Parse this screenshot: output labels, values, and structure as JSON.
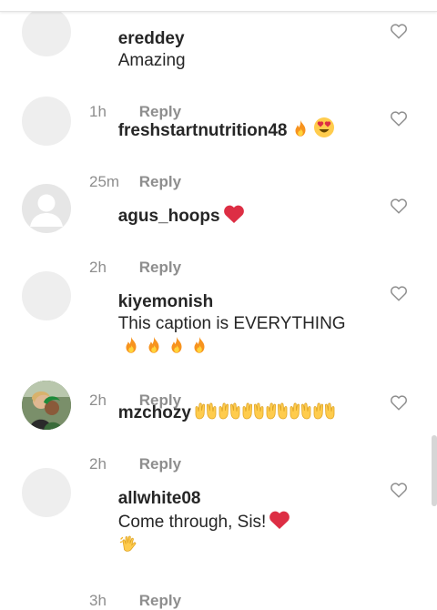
{
  "comments": [
    {
      "username": "ereddey",
      "text": "Amazing",
      "time": "1h",
      "reply": "Reply",
      "emoji": []
    },
    {
      "username": "freshstartnutrition48",
      "text": "",
      "time": "25m",
      "reply": "Reply",
      "emoji": [
        "fire",
        "heart-eyes"
      ]
    },
    {
      "username": "agus_hoops",
      "text": "",
      "time": "2h",
      "reply": "Reply",
      "emoji": [
        "red-heart"
      ]
    },
    {
      "username": "kiyemonish",
      "text": "This caption is EVERYTHING",
      "time": "2h",
      "reply": "Reply",
      "emoji": [
        "fire",
        "fire",
        "fire",
        "fire"
      ]
    },
    {
      "username": "mzchozy",
      "text": "",
      "time": "2h",
      "reply": "Reply",
      "emoji": [
        "raising-hands",
        "raising-hands",
        "raising-hands",
        "raising-hands",
        "raising-hands",
        "raising-hands"
      ]
    },
    {
      "username": "allwhite08",
      "text": "Come through, Sis!",
      "time": "3h",
      "reply": "Reply",
      "emoji": [
        "red-heart",
        "waving-hand"
      ]
    }
  ],
  "icons": {
    "like": "heart-outline-icon",
    "default_avatar": "default-avatar-icon"
  },
  "colors": {
    "text": "#262626",
    "meta": "#8e8e8e",
    "heart": "#ed4956",
    "fire": "#f7931e"
  }
}
